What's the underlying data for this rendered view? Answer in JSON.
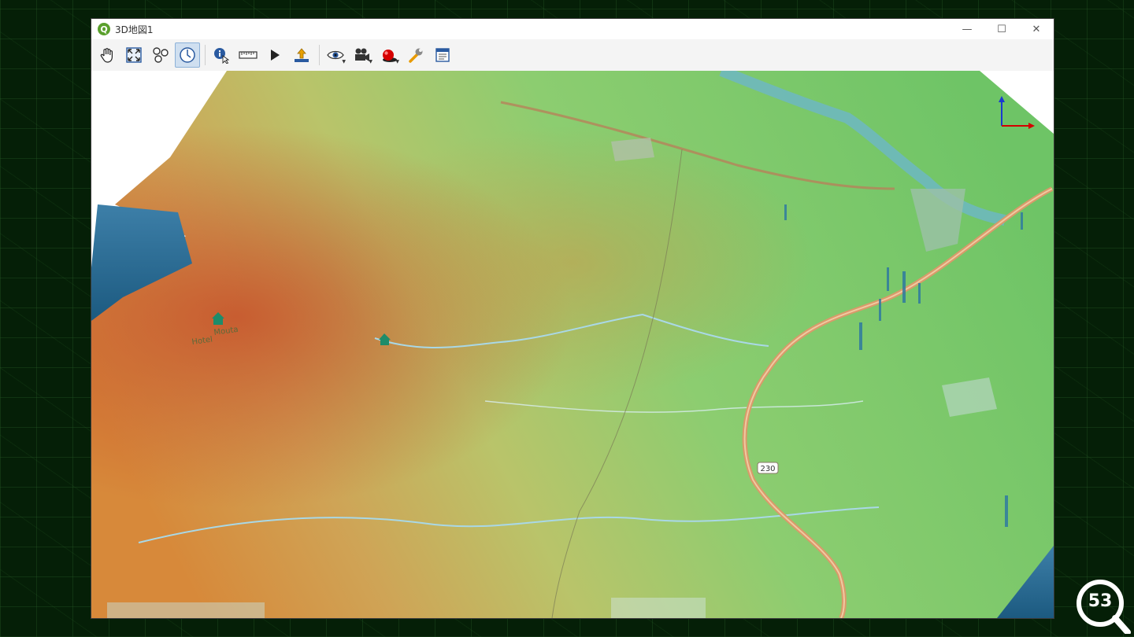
{
  "window": {
    "title": "3D地図1",
    "app_logo_letter": "Q",
    "controls": {
      "minimize": "—",
      "maximize": "☐",
      "close": "✕"
    }
  },
  "toolbar": {
    "tools": [
      {
        "name": "pan-tool",
        "icon": "hand-icon"
      },
      {
        "name": "zoom-full-tool",
        "icon": "zoom-full-icon"
      },
      {
        "name": "identify-graph-tool",
        "icon": "nodes-icon"
      },
      {
        "name": "camera-control-tool",
        "icon": "compass-icon",
        "active": true
      },
      {
        "name": "identify-tool",
        "icon": "info-cursor-icon"
      },
      {
        "name": "measure-tool",
        "icon": "ruler-icon"
      },
      {
        "name": "animation-tool",
        "icon": "play-icon"
      },
      {
        "name": "export-tool",
        "icon": "export-upload-icon"
      },
      {
        "name": "view-menu",
        "icon": "eye-icon",
        "dropdown": true
      },
      {
        "name": "camera-menu",
        "icon": "camera-icon",
        "dropdown": true
      },
      {
        "name": "effects-menu",
        "icon": "sphere-icon",
        "dropdown": true
      },
      {
        "name": "options-tool",
        "icon": "wrench-icon"
      },
      {
        "name": "layout-tool",
        "icon": "layout-icon"
      }
    ]
  },
  "map": {
    "labels": {
      "route_number": "230",
      "hotel_label": "Hotel",
      "hotel_label_name": "Mouta"
    },
    "axes": {
      "x_color": "#d40000",
      "y_color": "#1a3ad0"
    }
  },
  "badge": {
    "number": "53"
  }
}
